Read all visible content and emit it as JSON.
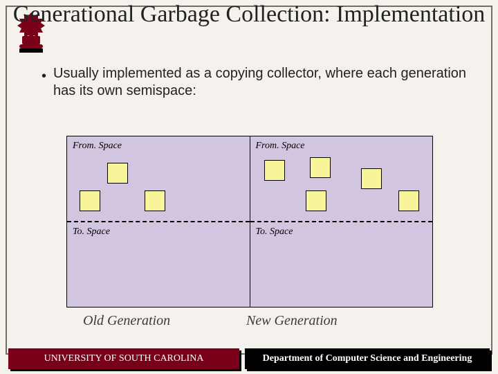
{
  "title": "Generational Garbage Collection: Implementation",
  "bullet": "Usually implemented as a copying collector, where each generation has its own semispace:",
  "diagram": {
    "from_label": "From. Space",
    "to_label": "To. Space",
    "old_caption": "Old Generation",
    "new_caption": "New Generation"
  },
  "footer": {
    "left": "UNIVERSITY OF SOUTH CAROLINA",
    "right": "Department of Computer Science and Engineering"
  },
  "colors": {
    "accent": "#7a0019",
    "block": "#f8f49a",
    "diagram_bg": "#d2c5df",
    "frame": "#6b7260"
  }
}
